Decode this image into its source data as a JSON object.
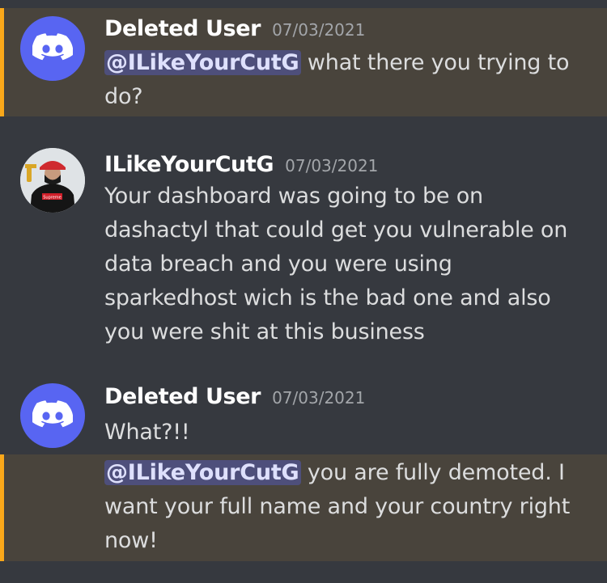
{
  "messages": [
    {
      "author": "Deleted User",
      "timestamp": "07/03/2021",
      "mention": "@ILikeYourCutG",
      "text": " what there you trying to do?"
    },
    {
      "author": "ILikeYourCutG",
      "timestamp": "07/03/2021",
      "text": "Your dashboard was going to be on dashactyl that could get you vulnerable on data breach and you were using sparkedhost wich is the bad one and also you were shit at this business"
    },
    {
      "author": "Deleted User",
      "timestamp": "07/03/2021",
      "text": "What?!!"
    },
    {
      "mention": "@ILikeYourCutG",
      "text": " you are fully demoted. I want your full name and your country right now!"
    }
  ],
  "avatar_shirt_text": "Supreme",
  "colors": {
    "background": "#36393f",
    "highlight": "#49443c",
    "highlight_border": "#faa81a",
    "discord_blurple": "#5865f2",
    "mention_bg": "rgba(88,101,242,0.35)"
  }
}
